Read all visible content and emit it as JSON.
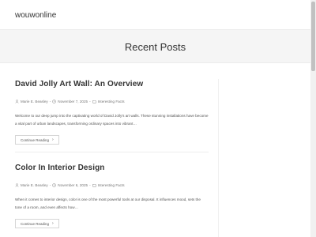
{
  "site": {
    "title": "wouwonline"
  },
  "page": {
    "title": "Recent Posts"
  },
  "posts": [
    {
      "title": "David Jolly Art Wall: An Overview",
      "author": "Marie E. Beasley",
      "date": "November 7, 2025",
      "category": "Interesting Facts",
      "excerpt": "Welcome to our deep jump into the captivating world of David Jolly's art walls. These stunning installations have become a vital part of urban landscapes, transforming ordinary spaces into vibrant…",
      "read_more": "Continue Reading"
    },
    {
      "title": "Color In Interior Design",
      "author": "Marie E. Beasley",
      "date": "November 6, 2025",
      "category": "Interesting Facts",
      "excerpt": "When it comes to interior design, color is one of the most powerful tools at our disposal. It influences mood, sets the tone of a room, and even affects how…",
      "read_more": "Continue Reading"
    }
  ],
  "icons": {
    "author": "user-icon",
    "date": "clock-icon",
    "category": "folder-icon",
    "read_more": "chevron-right-icon"
  },
  "colors": {
    "text": "#333333",
    "muted": "#777777",
    "banner_bg": "#f5f5f5"
  }
}
